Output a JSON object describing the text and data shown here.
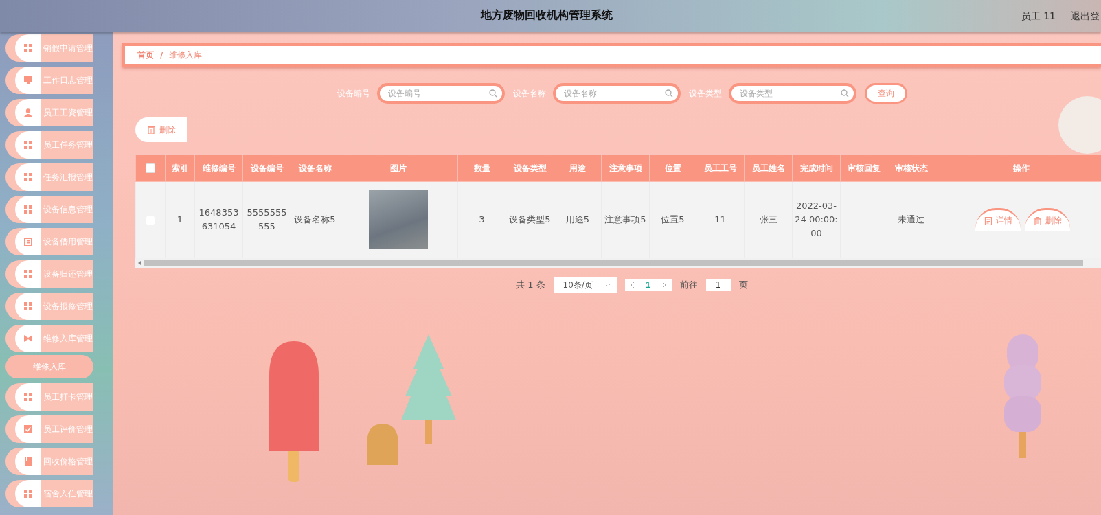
{
  "header": {
    "title": "地方废物回收机构管理系统",
    "user": "员工 11",
    "logout": "退出登"
  },
  "sidebar": {
    "items": [
      {
        "label": "销假申请管理"
      },
      {
        "label": "工作日志管理"
      },
      {
        "label": "员工工资管理"
      },
      {
        "label": "员工任务管理"
      },
      {
        "label": "任务汇报管理"
      },
      {
        "label": "设备信息管理"
      },
      {
        "label": "设备借用管理"
      },
      {
        "label": "设备归还管理"
      },
      {
        "label": "设备报修管理"
      },
      {
        "label": "维修入库管理",
        "children": [
          {
            "label": "维修入库",
            "selected": true
          }
        ]
      },
      {
        "label": "员工打卡管理"
      },
      {
        "label": "员工评价管理"
      },
      {
        "label": "回收价格管理"
      },
      {
        "label": "宿舍入住管理"
      }
    ]
  },
  "breadcrumb": {
    "items": [
      "首页",
      "维修入库"
    ],
    "separator": "/"
  },
  "search": {
    "fields": [
      {
        "label": "设备编号",
        "placeholder": "设备编号"
      },
      {
        "label": "设备名称",
        "placeholder": "设备名称"
      },
      {
        "label": "设备类型",
        "placeholder": "设备类型"
      }
    ],
    "button": "查询"
  },
  "toolbar": {
    "delete_button": "删除"
  },
  "table": {
    "select_all_checked": false,
    "columns": [
      "索引",
      "维修编号",
      "设备编号",
      "设备名称",
      "图片",
      "数量",
      "设备类型",
      "用途",
      "注意事项",
      "位置",
      "员工工号",
      "员工姓名",
      "完成时间",
      "审核回复",
      "审核状态",
      "操作"
    ],
    "rows": [
      {
        "selected": false,
        "cells": [
          {
            "kind": "text",
            "text": "1"
          },
          {
            "kind": "text",
            "text": "1648353631054"
          },
          {
            "kind": "text",
            "text": "5555555555"
          },
          {
            "kind": "text",
            "text": "设备名称5"
          },
          {
            "kind": "photo"
          },
          {
            "kind": "text",
            "text": "3"
          },
          {
            "kind": "text",
            "text": "设备类型5"
          },
          {
            "kind": "text",
            "text": "用途5"
          },
          {
            "kind": "text",
            "text": "注意事项5"
          },
          {
            "kind": "text",
            "text": "位置5"
          },
          {
            "kind": "text",
            "text": "11"
          },
          {
            "kind": "text",
            "text": "张三"
          },
          {
            "kind": "text",
            "text": "2022-03-24 00:00:00"
          },
          {
            "kind": "empty"
          },
          {
            "kind": "text",
            "text": "未通过"
          },
          {
            "kind": "actions",
            "buttons": [
              {
                "kind": "detail",
                "label": "详情"
              },
              {
                "kind": "delete",
                "label": "删除"
              }
            ]
          }
        ]
      }
    ]
  },
  "pagination": {
    "total": "共 1 条",
    "page_size": "10条/页",
    "current_page": "1",
    "goto_label": "前往",
    "goto_value": "1",
    "page_suffix": "页"
  }
}
